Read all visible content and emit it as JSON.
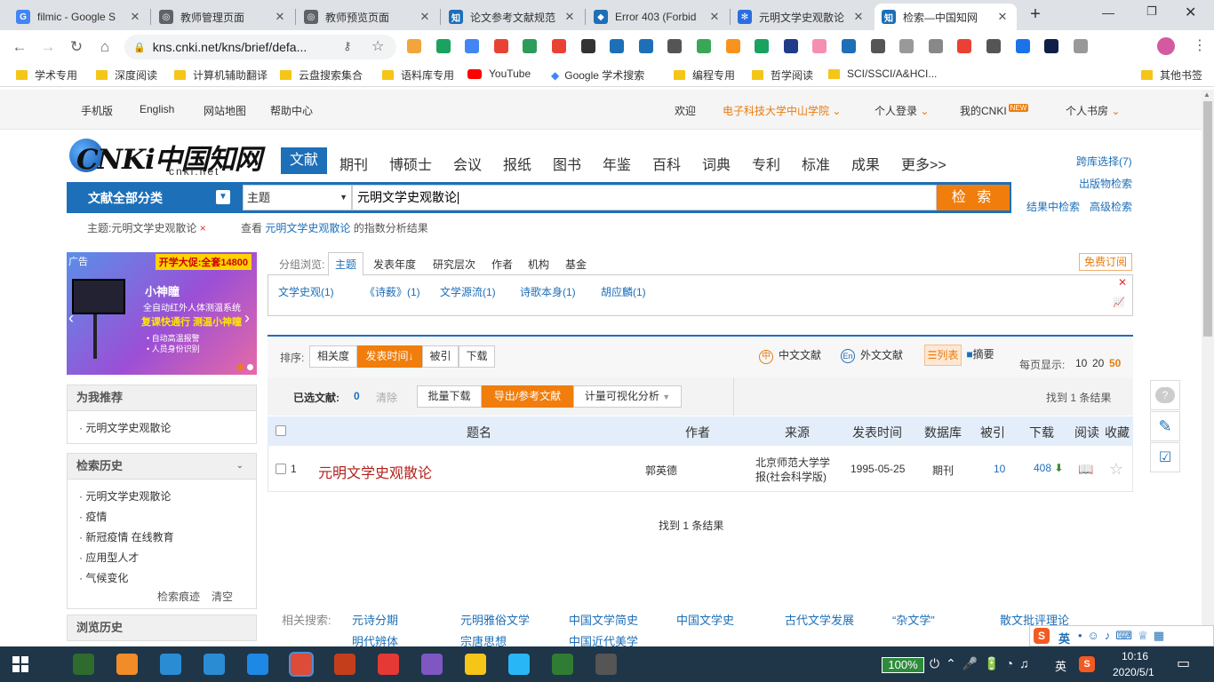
{
  "browser": {
    "tabs": [
      {
        "title": "filmic - Google S",
        "icon_color": "#4285f4",
        "icon": "G",
        "icon_name": "google-icon"
      },
      {
        "title": "教师管理页面",
        "icon_color": "#5f6368",
        "icon": "◎",
        "icon_name": "globe-icon"
      },
      {
        "title": "教师预览页面",
        "icon_color": "#5f6368",
        "icon": "◎",
        "icon_name": "globe-icon"
      },
      {
        "title": "论文参考文献规范",
        "icon_color": "#1d6fb8",
        "icon": "知",
        "icon_name": "zhihu-icon"
      },
      {
        "title": "Error 403 (Forbid",
        "icon_color": "#1d6fb8",
        "icon": "◆",
        "icon_name": "cube-icon"
      },
      {
        "title": "元明文学史观散论",
        "icon_color": "#2a6ee0",
        "icon": "✻",
        "icon_name": "paw-icon"
      },
      {
        "title": "检索—中国知网",
        "icon_color": "#1d6fb8",
        "icon": "知",
        "icon_name": "cnki-icon"
      }
    ],
    "url": "kns.cnki.net/kns/brief/defa...",
    "bookmarks": [
      "学术专用",
      "深度阅读",
      "计算机辅助翻译",
      "云盘搜索集合",
      "语料库专用",
      "YouTube",
      "Google 学术搜索",
      "编程专用",
      "哲学阅读",
      "SCI/SSCI/A&HCI..."
    ],
    "other_bookmarks": "其他书签"
  },
  "topnav": {
    "left": [
      "手机版",
      "English",
      "网站地图",
      "帮助中心"
    ],
    "welcome": "欢迎",
    "institution": "电子科技大学中山学院",
    "login": "个人登录",
    "mycnki": "我的CNKI",
    "new_badge": "NEW",
    "bookroom": "个人书房"
  },
  "logo": {
    "main": "CNKi中国知网",
    "sub": "cnki.net"
  },
  "categories": [
    "文献",
    "期刊",
    "博硕士",
    "会议",
    "报纸",
    "图书",
    "年鉴",
    "百科",
    "词典",
    "专利",
    "标准",
    "成果",
    "更多>>"
  ],
  "search": {
    "all_category": "文献全部分类",
    "field": "主题",
    "query": "元明文学史观散论",
    "button": "检 索",
    "cross_db": "跨库选择(7)",
    "publication": "出版物检索",
    "in_result": "结果中检索",
    "advanced": "高级检索"
  },
  "subline": {
    "topic_tag": "主题:元明文学史观散论",
    "view_prefix": "查看",
    "view_link": "元明文学史观散论",
    "view_suffix": "的指数分析结果"
  },
  "ad": {
    "label": "广告",
    "promo": "开学大促:全套14800",
    "brand": "小神瞳",
    "line1": "全自动红外人体测温系统",
    "line2": "复课快通行 测温小神瞳",
    "bullet1": "• 自动高温报警",
    "bullet2": "• 人员身份识别"
  },
  "recommend": {
    "title": "为我推荐",
    "items": [
      "元明文学史观散论"
    ]
  },
  "history": {
    "title": "检索历史",
    "items": [
      "元明文学史观散论",
      "疫情",
      "新冠疫情 在线教育",
      "应用型人才",
      "气候变化"
    ],
    "trace": "检索痕迹",
    "clear": "清空"
  },
  "browse_history": {
    "title": "浏览历史"
  },
  "group": {
    "label": "分组浏览:",
    "tabs": [
      "主题",
      "发表年度",
      "研究层次",
      "作者",
      "机构",
      "基金"
    ],
    "subscribe": "免费订阅",
    "items": [
      "文学史观(1)",
      "《诗薮》(1)",
      "文学源流(1)",
      "诗歌本身(1)",
      "胡应麟(1)"
    ]
  },
  "sort": {
    "label": "排序:",
    "options": [
      "相关度",
      "发表时间",
      "被引",
      "下载"
    ],
    "active": "发表时间",
    "chinese": "中文文献",
    "foreign": "外文文献",
    "list": "列表",
    "abstract": "摘要",
    "per_page_label": "每页显示:",
    "per_page": [
      "10",
      "20",
      "50"
    ]
  },
  "selection": {
    "selected_label": "已选文献:",
    "selected_count": "0",
    "clear": "清除",
    "batch": "批量下载",
    "export": "导出/参考文献",
    "viz": "计量可视化分析",
    "found": "找到 1 条结果"
  },
  "table": {
    "headers": [
      "题名",
      "作者",
      "来源",
      "发表时间",
      "数据库",
      "被引",
      "下载",
      "阅读",
      "收藏"
    ],
    "rows": [
      {
        "num": "1",
        "title": "元明文学史观散论",
        "author": "郭英德",
        "source": "北京师范大学学报(社会科学版)",
        "date": "1995-05-25",
        "db": "期刊",
        "cited": "10",
        "downloads": "408"
      }
    ]
  },
  "found_bottom": "找到 1 条结果",
  "related": {
    "label": "相关搜索:",
    "row1": [
      "元诗分期",
      "元明雅俗文学",
      "中国文学简史",
      "中国文学史",
      "古代文学发展",
      "“杂文学”",
      "散文批评理论"
    ],
    "row2": [
      "明代辨体",
      "宗唐思想",
      "中国近代美学"
    ]
  },
  "ime": {
    "lang": "英"
  },
  "taskbar": {
    "battery": "100%",
    "lang": "英",
    "time": "10:16",
    "date": "2020/5/1"
  }
}
